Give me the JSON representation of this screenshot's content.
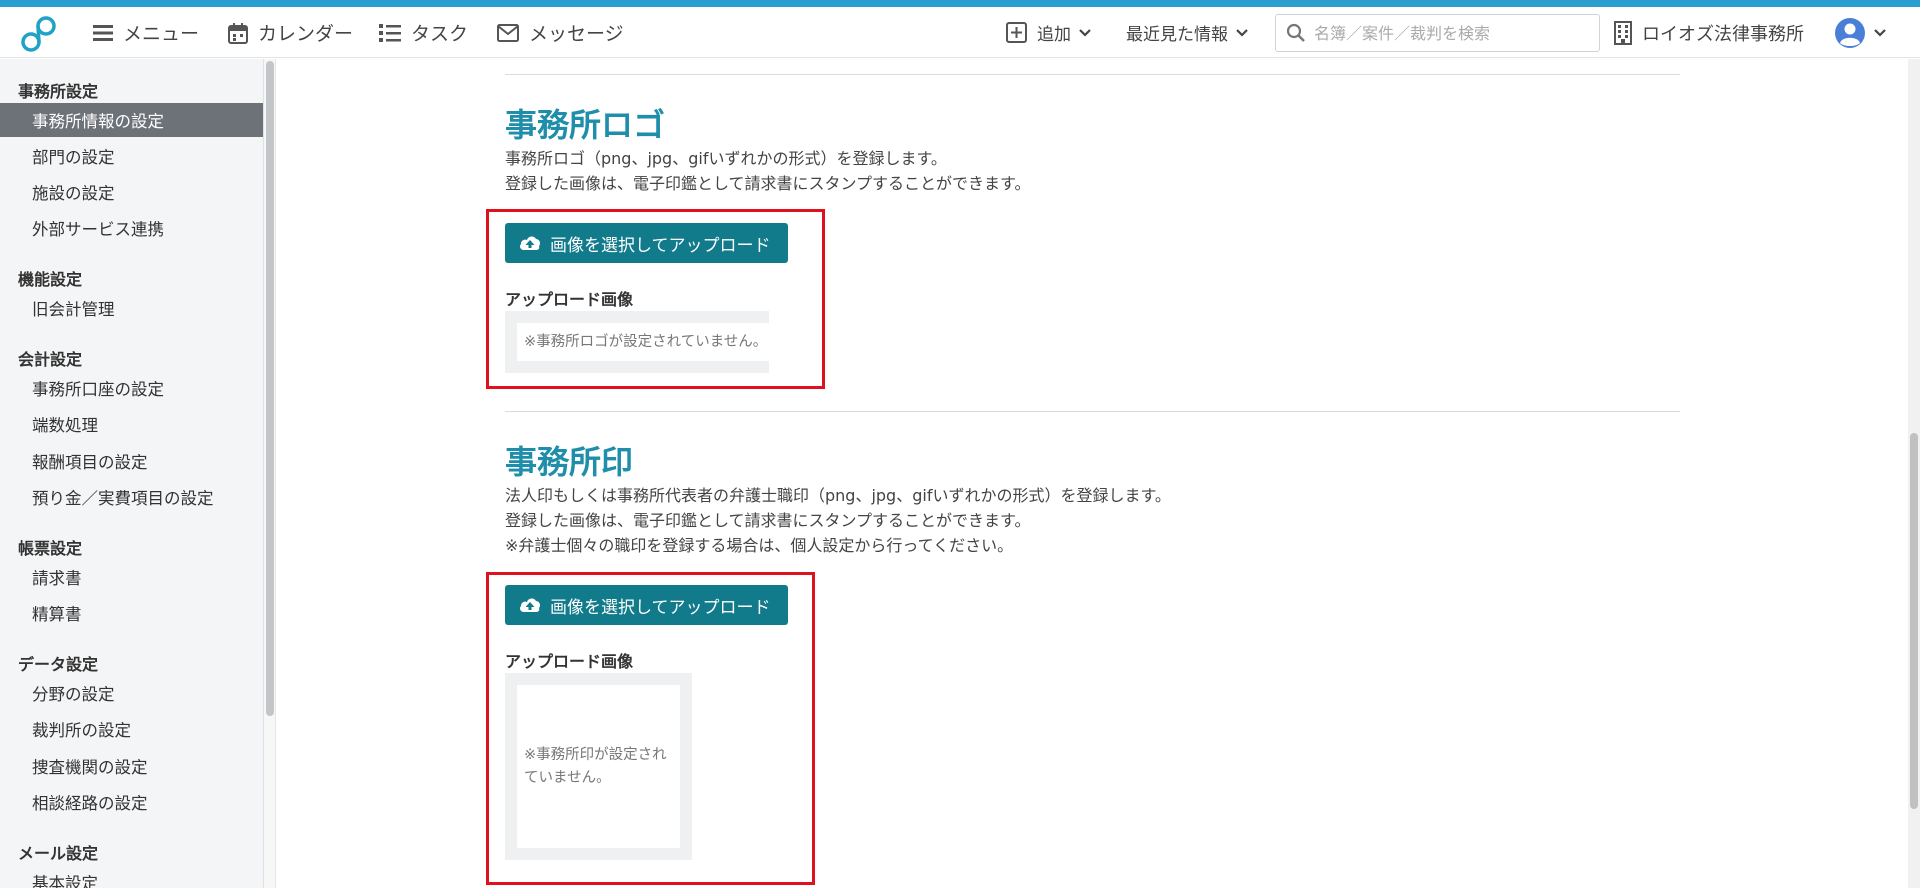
{
  "header": {
    "menu_label": "メニュー",
    "calendar_label": "カレンダー",
    "task_label": "タスク",
    "message_label": "メッセージ",
    "add_label": "追加",
    "recent_label": "最近見た情報",
    "search_placeholder": "名簿／案件／裁判を検索",
    "office_name": "ロイオズ法律事務所"
  },
  "sidebar": {
    "sections": [
      {
        "title": "事務所設定",
        "items": [
          "事務所情報の設定",
          "部門の設定",
          "施設の設定",
          "外部サービス連携"
        ]
      },
      {
        "title": "機能設定",
        "items": [
          "旧会計管理"
        ]
      },
      {
        "title": "会計設定",
        "items": [
          "事務所口座の設定",
          "端数処理",
          "報酬項目の設定",
          "預り金／実費項目の設定"
        ]
      },
      {
        "title": "帳票設定",
        "items": [
          "請求書",
          "精算書"
        ]
      },
      {
        "title": "データ設定",
        "items": [
          "分野の設定",
          "裁判所の設定",
          "捜査機関の設定",
          "相談経路の設定"
        ]
      },
      {
        "title": "メール設定",
        "items": [
          "基本設定"
        ]
      }
    ],
    "active_item": "事務所情報の設定"
  },
  "main": {
    "logo_section": {
      "title": "事務所ロゴ",
      "desc_lines": [
        "事務所ロゴ（png、jpg、gifいずれかの形式）を登録します。",
        "登録した画像は、電子印鑑として請求書にスタンプすることができます。"
      ],
      "upload_button": "画像を選択してアップロード",
      "upload_label": "アップロード画像",
      "empty_text": "※事務所ロゴが設定されていません。"
    },
    "seal_section": {
      "title": "事務所印",
      "desc_lines": [
        "法人印もしくは事務所代表者の弁護士職印（png、jpg、gifいずれかの形式）を登録します。",
        "登録した画像は、電子印鑑として請求書にスタンプすることができます。",
        "※弁護士個々の職印を登録する場合は、個人設定から行ってください。"
      ],
      "upload_button": "画像を選択してアップロード",
      "upload_label": "アップロード画像",
      "empty_text": "※事務所印が設定されていません。"
    }
  },
  "colors": {
    "accent_bar": "#2c9fcf",
    "title": "#1f8eaa",
    "button": "#117a8b",
    "highlight": "#e0111c"
  }
}
